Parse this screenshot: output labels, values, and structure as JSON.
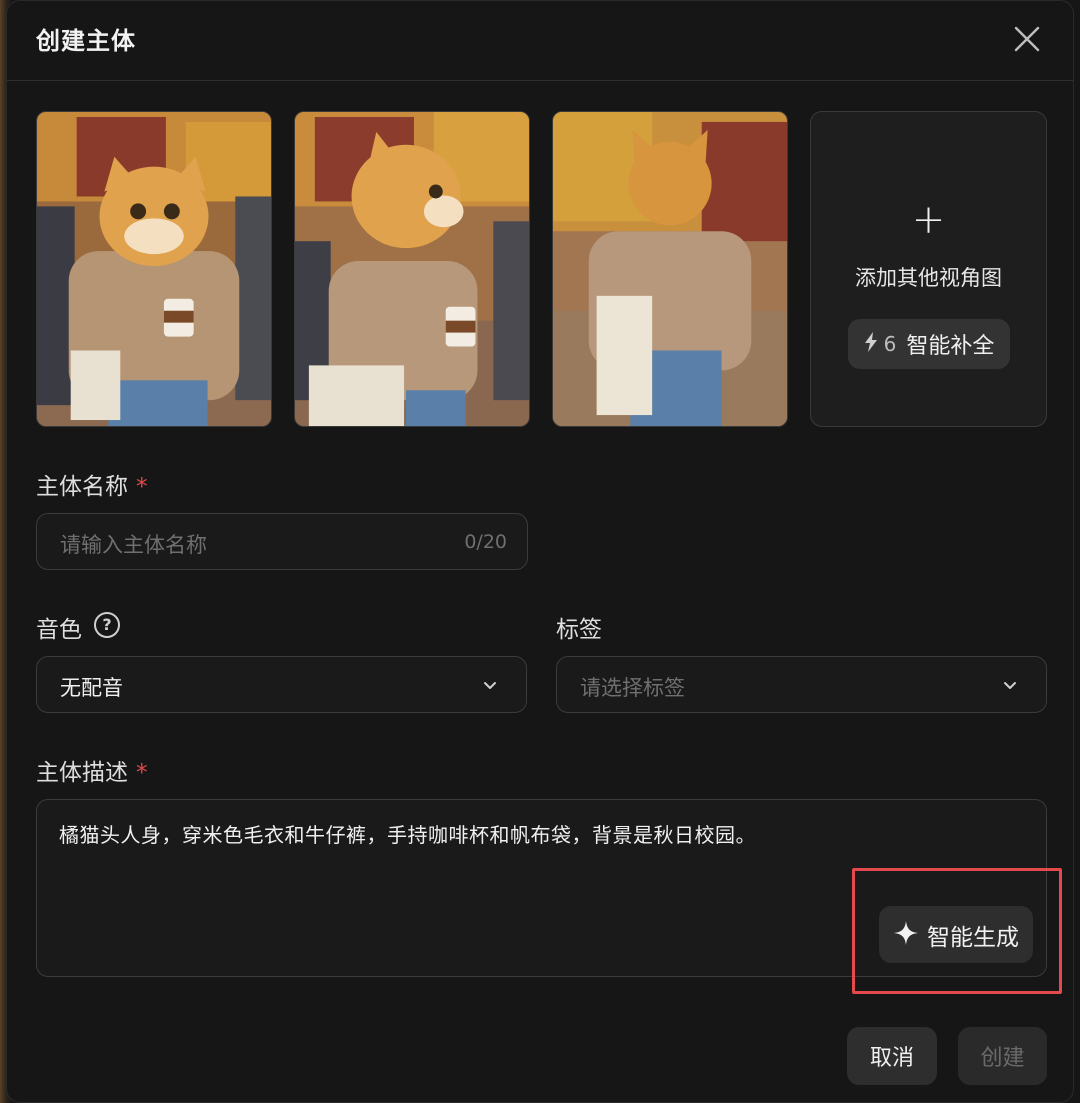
{
  "dialog": {
    "title": "创建主体",
    "close_icon": "close-icon"
  },
  "reference_images": [
    {
      "subject": "cat-head figure front view"
    },
    {
      "subject": "cat-head figure side view"
    },
    {
      "subject": "cat-head figure back view"
    }
  ],
  "add_view": {
    "plus": "+",
    "label": "添加其他视角图",
    "smart_fill": {
      "icon": "bolt-icon",
      "count": "6",
      "label": "智能补全"
    }
  },
  "name_field": {
    "label": "主体名称",
    "required_mark": "*",
    "placeholder": "请输入主体名称",
    "value": "",
    "counter": "0/20"
  },
  "voice_field": {
    "label": "音色",
    "help_icon": "?",
    "value": "无配音"
  },
  "tag_field": {
    "label": "标签",
    "placeholder": "请选择标签"
  },
  "description_field": {
    "label": "主体描述",
    "required_mark": "*",
    "value": "橘猫头人身，穿米色毛衣和牛仔裤，手持咖啡杯和帆布袋，背景是秋日校园。",
    "generate_button": {
      "icon": "sparkle-icon",
      "label": "智能生成"
    }
  },
  "footer": {
    "cancel_label": "取消",
    "create_label": "创建"
  },
  "colors": {
    "background": "#161616",
    "required": "#e5484d",
    "highlight": "#e5484d"
  }
}
